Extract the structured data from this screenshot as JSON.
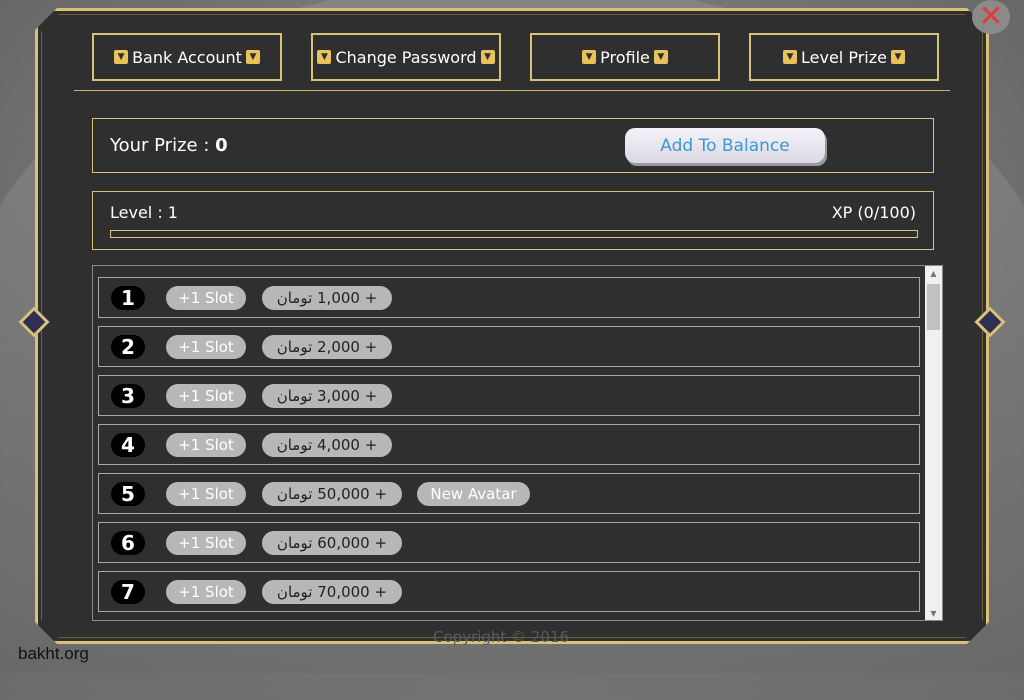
{
  "tabs": [
    {
      "label": "Bank Account"
    },
    {
      "label": "Change Password"
    },
    {
      "label": "Profile"
    },
    {
      "label": "Level Prize"
    }
  ],
  "prize": {
    "label": "Your Prize : ",
    "value": "0",
    "add_button": "Add To Balance"
  },
  "level": {
    "label": "Level : 1",
    "xp": "XP (0/100)",
    "xp_fraction": 0
  },
  "rows": [
    {
      "num": "1",
      "slot": "+1 Slot",
      "prize": "+ 1,000 تومان"
    },
    {
      "num": "2",
      "slot": "+1 Slot",
      "prize": "+ 2,000 تومان"
    },
    {
      "num": "3",
      "slot": "+1 Slot",
      "prize": "+ 3,000 تومان"
    },
    {
      "num": "4",
      "slot": "+1 Slot",
      "prize": "+ 4,000 تومان"
    },
    {
      "num": "5",
      "slot": "+1 Slot",
      "prize": "+ 50,000 تومان",
      "extra": "New Avatar"
    },
    {
      "num": "6",
      "slot": "+1 Slot",
      "prize": "+ 60,000 تومان"
    },
    {
      "num": "7",
      "slot": "+1 Slot",
      "prize": "+ 70,000 تومان"
    }
  ],
  "copyright": "Copyright © 2016",
  "watermark": "bakht.org",
  "colors": {
    "gold": "#d8c178",
    "panel": "#2f2f2f",
    "pill": "#b7b7b7",
    "close_red": "#e53935",
    "button_text": "#3a9ad0"
  },
  "icons": {
    "close": "close-icon",
    "tab_chevron": "chevron-down-icon"
  }
}
